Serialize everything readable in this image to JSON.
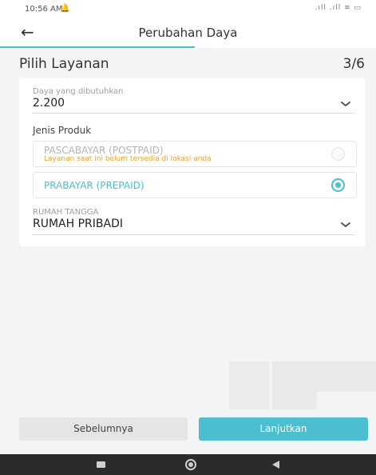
{
  "status_bar": {
    "time": "10:56 AM",
    "icons_text": ".ıll .ıll ≋ ▭"
  },
  "header": {
    "back_icon": "←",
    "title": "Perubahan Daya"
  },
  "step": {
    "title": "Pilih Layanan",
    "count": "3/6"
  },
  "form": {
    "power": {
      "label": "Daya yang dibutuhkan",
      "value": "2.200"
    },
    "product": {
      "label": "Jenis Produk",
      "options": [
        {
          "label": "PASCABAYAR (POSTPAID)",
          "note": "Layanan saat ini belum tersedia di lokasi anda",
          "selected": false,
          "enabled": false
        },
        {
          "label": "PRABAYAR (PREPAID)",
          "note": "",
          "selected": true,
          "enabled": true
        }
      ]
    },
    "category": {
      "label": "RUMAH TANGGA",
      "value": "RUMAH PRIBADI"
    }
  },
  "buttons": {
    "prev_label": "Sebelumnya",
    "next_label": "Lanjutkan"
  },
  "colors": {
    "accent": "#4cbfcf",
    "warning_text": "#e3a53a",
    "disabled_text": "#b0b4b8"
  },
  "icons": {
    "back": "arrow-left-icon",
    "dropdown": "chevron-down-icon",
    "bell": "bell-icon"
  }
}
